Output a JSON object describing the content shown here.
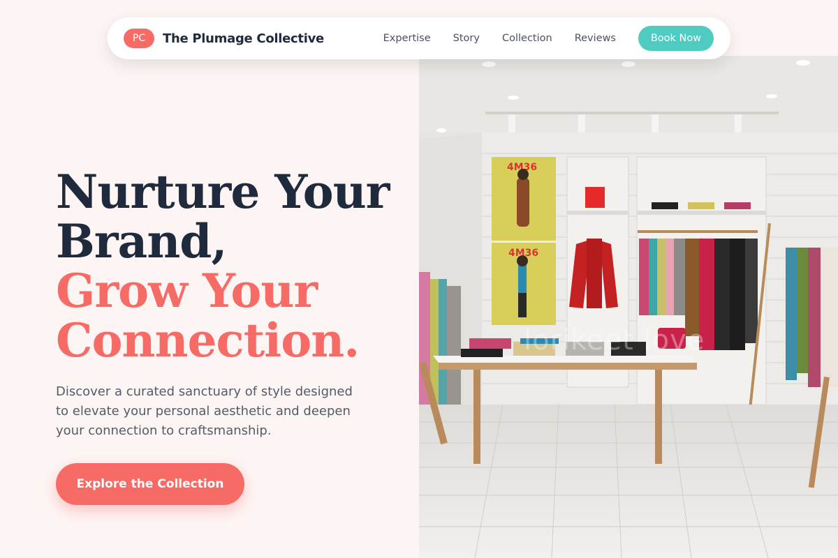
{
  "nav": {
    "logo_initials": "PC",
    "brand_name": "The Plumage Collective",
    "links": [
      "Expertise",
      "Story",
      "Collection",
      "Reviews"
    ],
    "book_label": "Book Now"
  },
  "hero": {
    "headline_line1": "Nurture Your",
    "headline_line2": "Brand,",
    "headline_line3": "Grow Your",
    "headline_line4": "Connection.",
    "subtext": "Discover a curated sanctuary of style designed to elevate your personal aesthetic and deepen your connection to craftsmanship.",
    "cta_label": "Explore the Collection",
    "image_watermark": "lorikeet love",
    "poster_text": "4M36"
  },
  "colors": {
    "accent": "#f76b66",
    "teal": "#4fcbc1",
    "navy": "#1f2a3d",
    "background": "#fdf5f4"
  }
}
